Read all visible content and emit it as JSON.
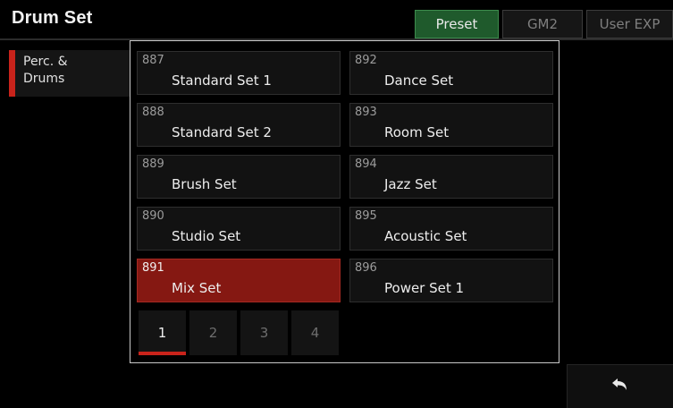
{
  "header": {
    "title": "Drum Set",
    "tabs": [
      {
        "label": "Preset",
        "active": true
      },
      {
        "label": "GM2",
        "active": false
      },
      {
        "label": "User EXP",
        "active": false
      }
    ]
  },
  "sidebar": {
    "items": [
      {
        "label": "Perc. &\nDrums",
        "active": true
      }
    ]
  },
  "voices": [
    {
      "number": "887",
      "name": "Standard Set 1"
    },
    {
      "number": "888",
      "name": "Standard Set 2"
    },
    {
      "number": "889",
      "name": "Brush Set"
    },
    {
      "number": "890",
      "name": "Studio Set"
    },
    {
      "number": "891",
      "name": "Mix Set",
      "selected": true
    },
    {
      "number": "892",
      "name": "Dance Set"
    },
    {
      "number": "893",
      "name": "Room Set"
    },
    {
      "number": "894",
      "name": "Jazz Set"
    },
    {
      "number": "895",
      "name": "Acoustic Set"
    },
    {
      "number": "896",
      "name": "Power Set 1"
    }
  ],
  "pagination": {
    "pages": [
      "1",
      "2",
      "3",
      "4"
    ],
    "current": "1"
  },
  "icons": {
    "back": "return-arrow-icon"
  },
  "colors": {
    "accent_red": "#c8231b",
    "selected_card": "#851812",
    "active_tab": "#1f5a2c"
  }
}
